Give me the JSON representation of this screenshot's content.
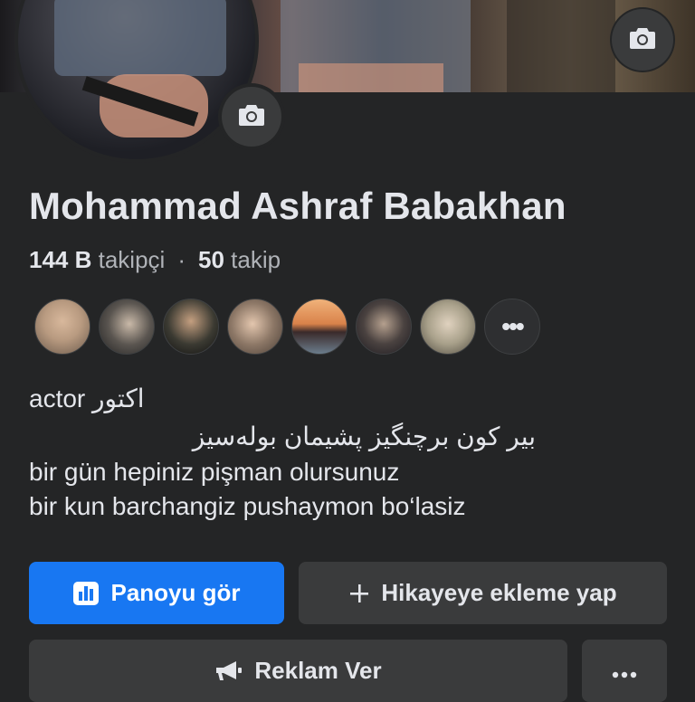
{
  "profile": {
    "name": "Mohammad Ashraf Babakhan",
    "followers_count": "144 B",
    "followers_label": "takipçi",
    "separator": "·",
    "following_count": "50",
    "following_label": "takip"
  },
  "friends": {
    "more_label": "•••",
    "avatar_colors": [
      "#b89a80",
      "#5a5550",
      "#3b3a32",
      "#8c7766",
      "#d9824a",
      "#4a4240",
      "#a8a08a"
    ]
  },
  "bio": {
    "line1": "actor اکتور",
    "line2": "بیر کون برچنگیز پشیمان بوله‌سیز",
    "line3": "bir gün hepiniz pişman olursunuz",
    "line4": "bir kun barchangiz pushaymon bo‘lasiz"
  },
  "actions": {
    "dashboard_label": "Panoyu gör",
    "add_story_label": "Hikayeye ekleme yap",
    "advertise_label": "Reklam Ver",
    "more_label": "more"
  },
  "icons": {
    "cover_camera": "camera-icon",
    "avatar_camera": "camera-icon",
    "dashboard": "bar-chart-icon",
    "add": "plus-icon",
    "advertise": "megaphone-icon",
    "more": "ellipsis-icon"
  },
  "colors": {
    "background": "#242526",
    "primary": "#1877f2",
    "secondary_button": "#3a3b3c",
    "text": "#e4e6eb",
    "muted_text": "#b0b3b8"
  }
}
